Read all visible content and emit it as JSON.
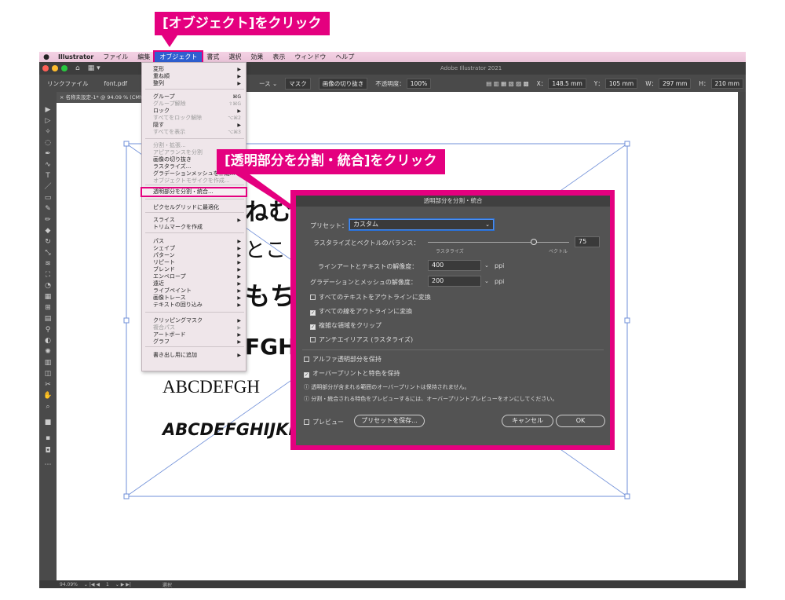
{
  "callouts": {
    "top": "[オブジェクト]をクリック",
    "mid": "[透明部分を分割・統合]をクリック"
  },
  "menubar": {
    "apple": "",
    "items": [
      "Illustrator",
      "ファイル",
      "編集",
      "オブジェクト",
      "書式",
      "選択",
      "効果",
      "表示",
      "ウィンドウ",
      "ヘルプ"
    ]
  },
  "titlebar": {
    "app_title": "Adobe Illustrator 2021",
    "workspace_icon": "▦ ▾"
  },
  "controlbar": {
    "link_file": "リンクファイル",
    "file_name": "font.pdf",
    "source": "ース ⌄",
    "mask": "マスク",
    "crop": "画像の切り抜き",
    "opacity_label": "不透明度：",
    "opacity": "100%",
    "x_label": "X：",
    "x": "148.5 mm",
    "y_label": "Y：",
    "y": "105 mm",
    "w_label": "W：",
    "w": "297 mm",
    "h_label": "H：",
    "h": "210 mm"
  },
  "doc_tab": "名称未設定-1* @ 94.09 % (CMYK/",
  "status": {
    "zoom": "94.09%",
    "page": "1",
    "tool": "選択"
  },
  "artboard": {
    "lines": [
      "ABCDEFGH",
      "ABCDEFGHIJKL",
      "FGH",
      "もち",
      "とこ",
      "ねむ"
    ]
  },
  "object_menu": {
    "items": [
      {
        "label": "変形",
        "arrow": "▶",
        "sc": ""
      },
      {
        "label": "重ね順",
        "arrow": "▶",
        "sc": ""
      },
      {
        "label": "整列",
        "arrow": "▶",
        "sc": ""
      },
      {
        "label": "グループ",
        "arrow": "",
        "sc": "⌘G"
      },
      {
        "label": "グループ解除",
        "arrow": "",
        "sc": "⇧⌘G"
      },
      {
        "label": "ロック",
        "arrow": "▶",
        "sc": ""
      },
      {
        "label": "すべてをロック解除",
        "arrow": "",
        "sc": "⌥⌘2"
      },
      {
        "label": "隠す",
        "arrow": "▶",
        "sc": ""
      },
      {
        "label": "すべてを表示",
        "arrow": "",
        "sc": "⌥⌘3"
      },
      {
        "label": "分割・拡張...",
        "arrow": "",
        "sc": ""
      },
      {
        "label": "アピアランスを分割",
        "arrow": "",
        "sc": ""
      },
      {
        "label": "画像の切り抜き",
        "arrow": "",
        "sc": ""
      },
      {
        "label": "ラスタライズ...",
        "arrow": "",
        "sc": ""
      },
      {
        "label": "グラデーションメッシュを作成...",
        "arrow": "",
        "sc": ""
      },
      {
        "label": "オブジェクトモザイクを作成...",
        "arrow": "",
        "sc": ""
      },
      {
        "label": "透明部分を分割・統合...",
        "arrow": "",
        "sc": ""
      },
      {
        "label": "ピクセルグリッドに最適化",
        "arrow": "",
        "sc": ""
      },
      {
        "label": "スライス",
        "arrow": "▶",
        "sc": ""
      },
      {
        "label": "トリムマークを作成",
        "arrow": "",
        "sc": ""
      },
      {
        "label": "パス",
        "arrow": "▶",
        "sc": ""
      },
      {
        "label": "シェイプ",
        "arrow": "▶",
        "sc": ""
      },
      {
        "label": "パターン",
        "arrow": "▶",
        "sc": ""
      },
      {
        "label": "リピート",
        "arrow": "▶",
        "sc": ""
      },
      {
        "label": "ブレンド",
        "arrow": "▶",
        "sc": ""
      },
      {
        "label": "エンベロープ",
        "arrow": "▶",
        "sc": ""
      },
      {
        "label": "遠近",
        "arrow": "▶",
        "sc": ""
      },
      {
        "label": "ライブペイント",
        "arrow": "▶",
        "sc": ""
      },
      {
        "label": "画像トレース",
        "arrow": "▶",
        "sc": ""
      },
      {
        "label": "テキストの回り込み",
        "arrow": "▶",
        "sc": ""
      },
      {
        "label": "クリッピングマスク",
        "arrow": "▶",
        "sc": ""
      },
      {
        "label": "複合パス",
        "arrow": "▶",
        "sc": ""
      },
      {
        "label": "アートボード",
        "arrow": "▶",
        "sc": ""
      },
      {
        "label": "グラフ",
        "arrow": "▶",
        "sc": ""
      },
      {
        "label": "書き出し用に追加",
        "arrow": "▶",
        "sc": ""
      }
    ]
  },
  "dialog": {
    "title": "透明部分を分割・統合",
    "preset_label": "プリセット：",
    "preset_value": "カスタム",
    "balance_label": "ラスタライズとベクトルのバランス：",
    "balance_value": "75",
    "balance_fraction": 0.75,
    "raster_label": "ラスタライズ",
    "vector_label": "ベクトル",
    "line_res_label": "ラインアートとテキストの解像度：",
    "line_res_value": "400",
    "grad_res_label": "グラデーションとメッシュの解像度：",
    "grad_res_value": "200",
    "ppi": "ppi",
    "chk_text_outline": "すべてのテキストをアウトラインに変換",
    "chk_stroke_outline": "すべての線をアウトラインに変換",
    "chk_clip": "複雑な領域をクリップ",
    "chk_antialias": "アンチエイリアス (ラスタライズ)",
    "chk_alpha": "アルファ透明部分を保持",
    "chk_overprint": "オーバープリントと特色を保持",
    "info1": "ⓘ 透明部分が含まれる範囲のオーバープリントは保持されません。",
    "info2": "ⓘ 分割・統合される特色をプレビューするには、オーバープリントプレビューをオンにしてください。",
    "preview_label": "プレビュー",
    "save_preset": "プリセットを保存...",
    "cancel": "キャンセル",
    "ok": "OK"
  },
  "colors": {
    "accent": "#e4007f",
    "menu_highlight": "#2f5fd0"
  }
}
